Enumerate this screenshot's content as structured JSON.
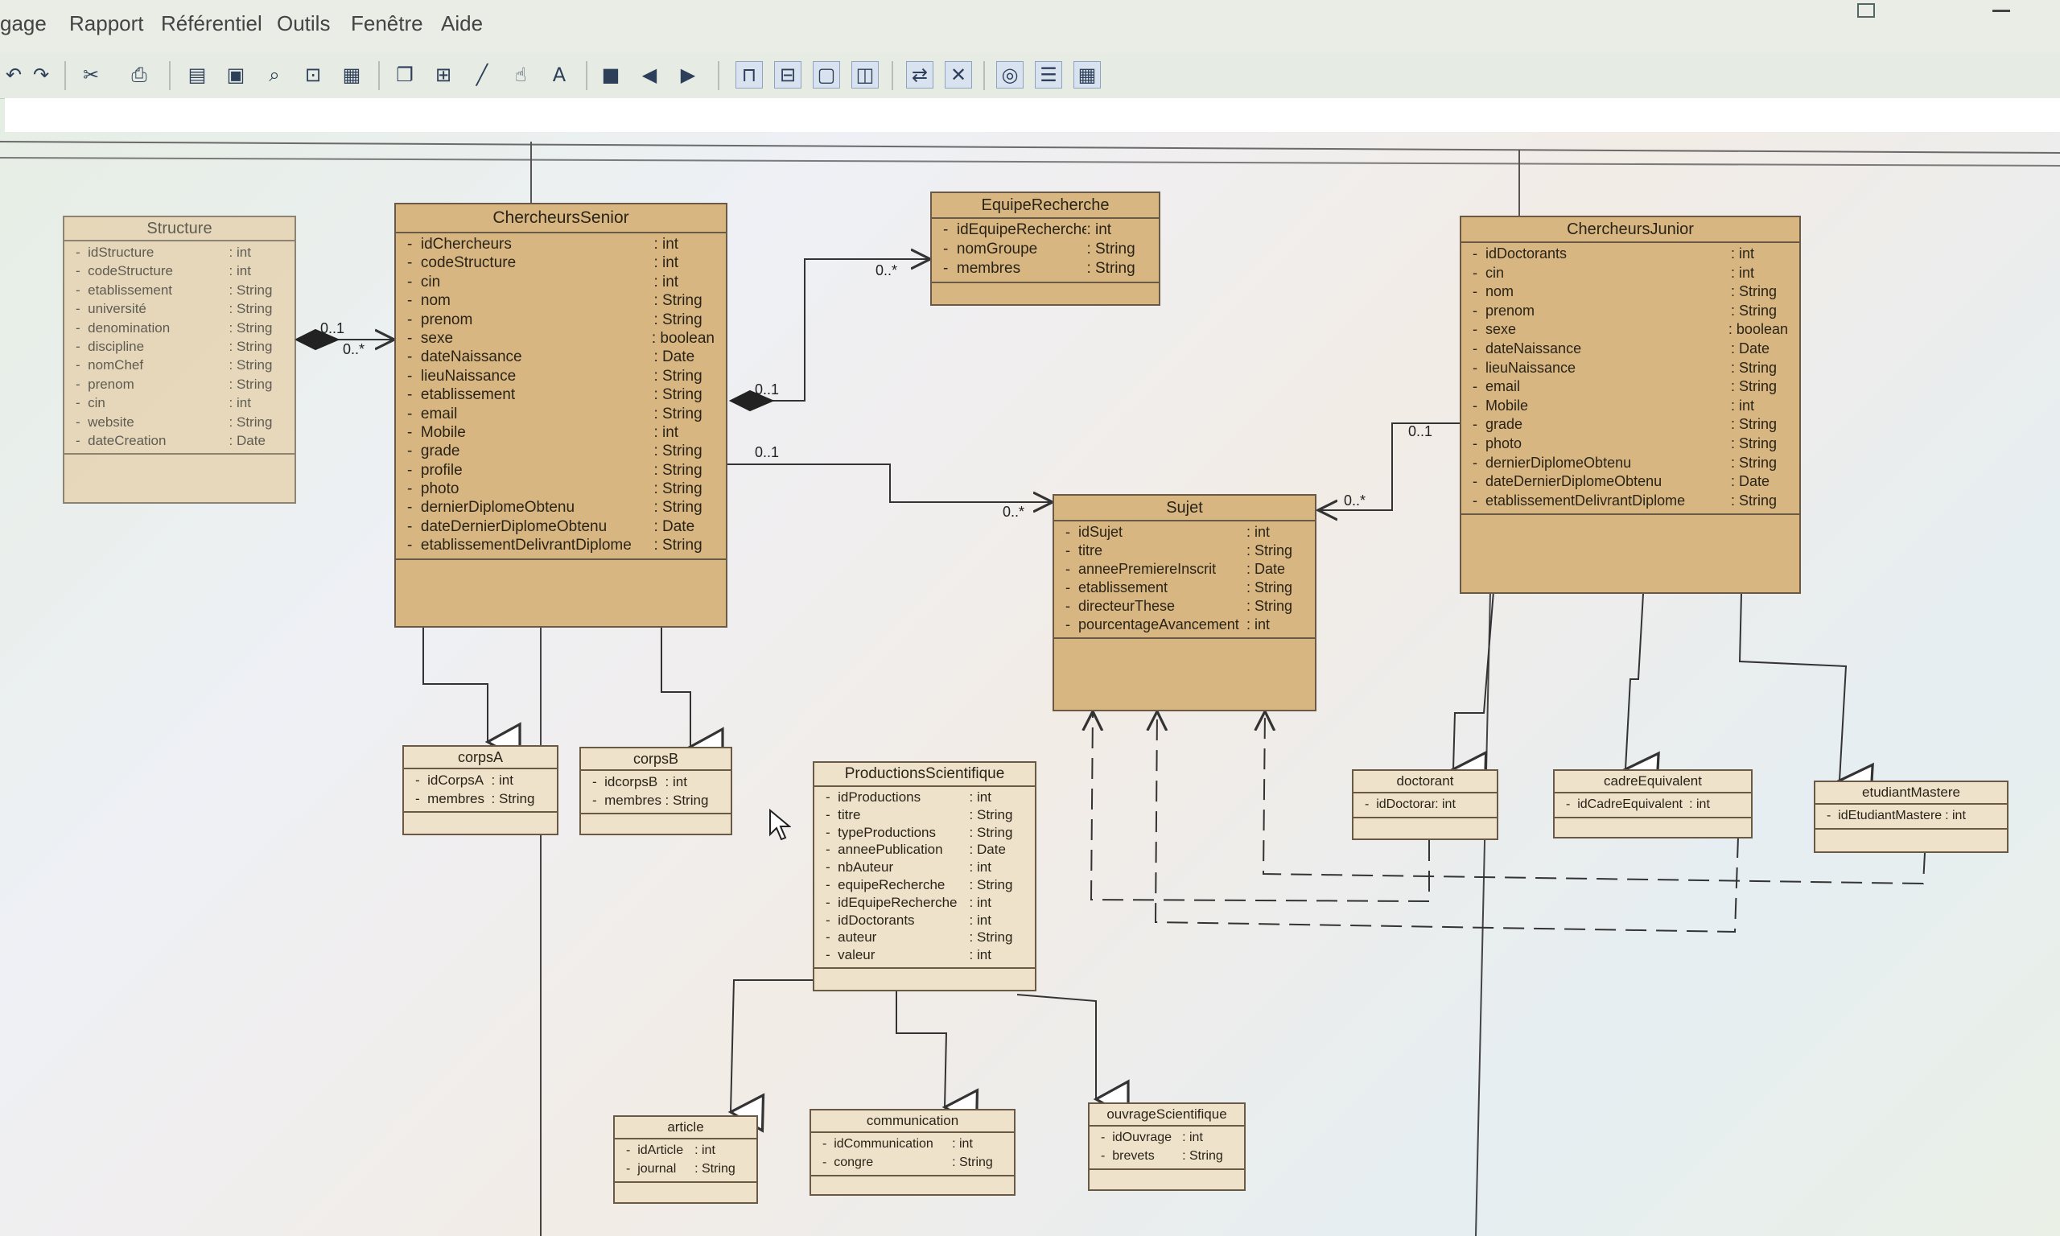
{
  "menu": {
    "items": [
      "gage",
      "Rapport",
      "Référentiel",
      "Outils",
      "Fenêtre",
      "Aide"
    ]
  },
  "toolbar": {
    "icons": [
      "undo-icon",
      "redo-icon",
      "cut-icon",
      "print-icon",
      "open-icon",
      "save-icon",
      "find-icon",
      "zoom-icon",
      "export-icon",
      "copy-icon",
      "frame-icon",
      "line-icon",
      "pointer-icon",
      "text-icon",
      "folder-icon",
      "back-icon",
      "forward-icon",
      "class-icon",
      "package-icon",
      "note-icon",
      "interface-icon",
      "link-icon",
      "close-icon",
      "view-icon",
      "list-icon",
      "grid-icon"
    ]
  },
  "diagram": {
    "classes": [
      {
        "id": "structure",
        "title": "Structure",
        "attrs": [
          [
            "idStructure",
            "int"
          ],
          [
            "codeStructure",
            "int"
          ],
          [
            "etablissement",
            "String"
          ],
          [
            "université",
            "String"
          ],
          [
            "denomination",
            "String"
          ],
          [
            "discipline",
            "String"
          ],
          [
            "nomChef",
            "String"
          ],
          [
            "prenom",
            "String"
          ],
          [
            "cin",
            "int"
          ],
          [
            "website",
            "String"
          ],
          [
            "dateCreation",
            "Date"
          ]
        ]
      },
      {
        "id": "chercheurs-senior",
        "title": "ChercheursSenior",
        "attrs": [
          [
            "idChercheurs",
            "int"
          ],
          [
            "codeStructure",
            "int"
          ],
          [
            "cin",
            "int"
          ],
          [
            "nom",
            "String"
          ],
          [
            "prenom",
            "String"
          ],
          [
            "sexe",
            "boolean"
          ],
          [
            "dateNaissance",
            "Date"
          ],
          [
            "lieuNaissance",
            "String"
          ],
          [
            "etablissement",
            "String"
          ],
          [
            "email",
            "String"
          ],
          [
            "Mobile",
            "int"
          ],
          [
            "grade",
            "String"
          ],
          [
            "profile",
            "String"
          ],
          [
            "photo",
            "String"
          ],
          [
            "dernierDiplomeObtenu",
            "String"
          ],
          [
            "dateDernierDiplomeObtenu",
            "Date"
          ],
          [
            "etablissementDelivrantDiplome",
            "String"
          ]
        ]
      },
      {
        "id": "equipe-recherche",
        "title": "EquipeRecherche",
        "attrs": [
          [
            "idEquipeRecherche",
            "int"
          ],
          [
            "nomGroupe",
            "String"
          ],
          [
            "membres",
            "String"
          ]
        ]
      },
      {
        "id": "chercheurs-junior",
        "title": "ChercheursJunior",
        "attrs": [
          [
            "idDoctorants",
            "int"
          ],
          [
            "cin",
            "int"
          ],
          [
            "nom",
            "String"
          ],
          [
            "prenom",
            "String"
          ],
          [
            "sexe",
            "boolean"
          ],
          [
            "dateNaissance",
            "Date"
          ],
          [
            "lieuNaissance",
            "String"
          ],
          [
            "email",
            "String"
          ],
          [
            "Mobile",
            "int"
          ],
          [
            "grade",
            "String"
          ],
          [
            "photo",
            "String"
          ],
          [
            "dernierDiplomeObtenu",
            "String"
          ],
          [
            "dateDernierDiplomeObtenu",
            "Date"
          ],
          [
            "etablissementDelivrantDiplome",
            "String"
          ]
        ]
      },
      {
        "id": "sujet",
        "title": "Sujet",
        "attrs": [
          [
            "idSujet",
            "int"
          ],
          [
            "titre",
            "String"
          ],
          [
            "anneePremiereInscrit",
            "Date"
          ],
          [
            "etablissement",
            "String"
          ],
          [
            "directeurThese",
            "String"
          ],
          [
            "pourcentageAvancement",
            "int"
          ]
        ]
      },
      {
        "id": "corps-a",
        "title": "corpsA",
        "attrs": [
          [
            "idCorpsA",
            "int"
          ],
          [
            "membres",
            "String"
          ]
        ]
      },
      {
        "id": "corps-b",
        "title": "corpsB",
        "attrs": [
          [
            "idcorpsB",
            "int"
          ],
          [
            "membres",
            "String"
          ]
        ]
      },
      {
        "id": "productions",
        "title": "ProductionsScientifique",
        "attrs": [
          [
            "idProductions",
            "int"
          ],
          [
            "titre",
            "String"
          ],
          [
            "typeProductions",
            "String"
          ],
          [
            "anneePublication",
            "Date"
          ],
          [
            "nbAuteur",
            "int"
          ],
          [
            "equipeRecherche",
            "String"
          ],
          [
            "idEquipeRecherche",
            "int"
          ],
          [
            "idDoctorants",
            "int"
          ],
          [
            "auteur",
            "String"
          ],
          [
            "valeur",
            "int"
          ]
        ]
      },
      {
        "id": "doctorant",
        "title": "doctorant",
        "attrs": [
          [
            "idDoctorant",
            "int"
          ]
        ]
      },
      {
        "id": "cadre-equivalent",
        "title": "cadreEquivalent",
        "attrs": [
          [
            "idCadreEquivalent",
            "int"
          ]
        ]
      },
      {
        "id": "etudiant-mastere",
        "title": "etudiantMastere",
        "attrs": [
          [
            "idEtudiantMastere",
            "int"
          ]
        ]
      },
      {
        "id": "article",
        "title": "article",
        "attrs": [
          [
            "idArticle",
            "int"
          ],
          [
            "journal",
            "String"
          ]
        ]
      },
      {
        "id": "communication",
        "title": "communication",
        "attrs": [
          [
            "idCommunication",
            "int"
          ],
          [
            "congre",
            "String"
          ]
        ]
      },
      {
        "id": "ouvrage",
        "title": "ouvrageScientifique",
        "attrs": [
          [
            "idOuvrage",
            "int"
          ],
          [
            "brevets",
            "String"
          ]
        ]
      }
    ],
    "relations": {
      "struct_one": "0..1",
      "struct_many": "0..*",
      "equipe_one": "0..1",
      "equipe_many": "0..*",
      "sujet_one": "0..1",
      "sujet_many": "0..*",
      "junior_one": "0..1",
      "junior_many": "0..*"
    }
  },
  "colors": {
    "class_fill": "#d8b682",
    "class_border": "#6a5a45",
    "background": "#e8efe8"
  }
}
